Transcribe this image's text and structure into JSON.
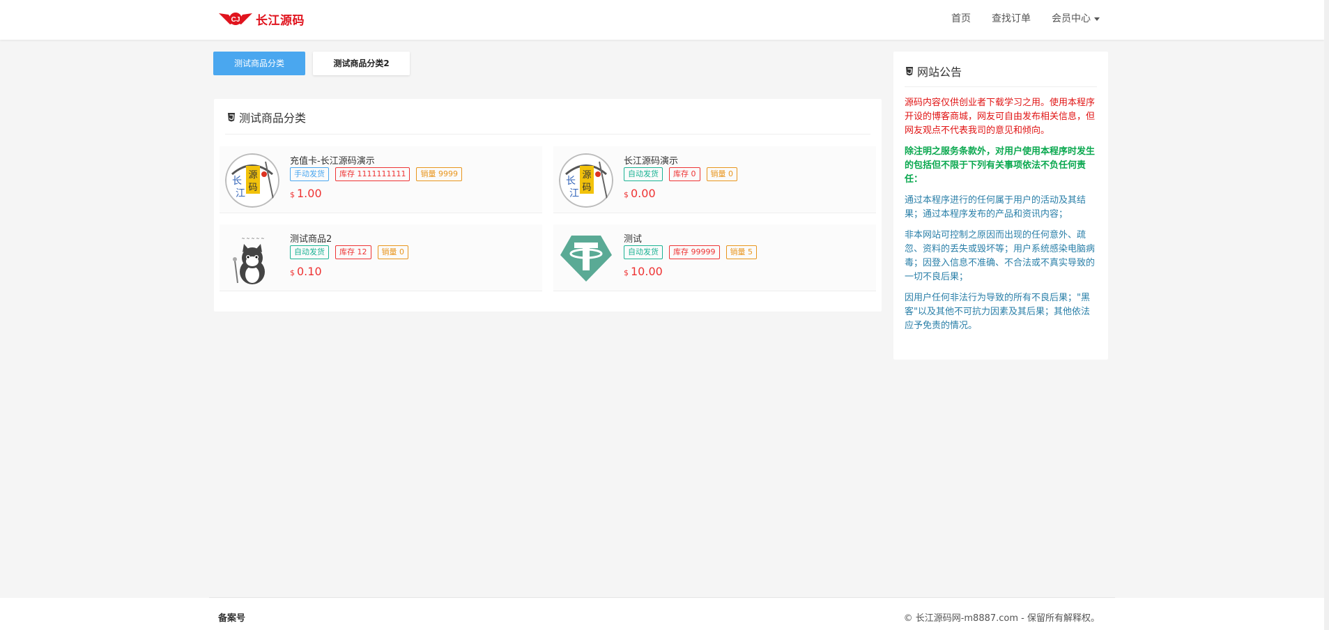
{
  "header": {
    "logo_text": "长江源码",
    "nav": [
      "首页",
      "查找订单",
      "会员中心"
    ]
  },
  "tabs": [
    "测试商品分类",
    "测试商品分类2"
  ],
  "panel": {
    "title": "测试商品分类",
    "products": [
      {
        "name": "充值卡-长江源码演示",
        "delivery": "手动发货",
        "stock": "库存 1111111111",
        "sales": "销量 9999",
        "currency": "$",
        "price": "1.00",
        "image": "changjiang-seal",
        "delivery_color": "blue"
      },
      {
        "name": "长江源码演示",
        "delivery": "自动发货",
        "stock": "库存 0",
        "sales": "销量 0",
        "currency": "$",
        "price": "0.00",
        "image": "changjiang-seal",
        "delivery_color": "green"
      },
      {
        "name": "测试商品2",
        "delivery": "自动发货",
        "stock": "库存 12",
        "sales": "销量 0",
        "currency": "$",
        "price": "0.10",
        "image": "cat-image",
        "delivery_color": "green"
      },
      {
        "name": "测试",
        "delivery": "自动发货",
        "stock": "库存 99999",
        "sales": "销量 5",
        "currency": "$",
        "price": "10.00",
        "image": "tether-icon",
        "delivery_color": "green"
      }
    ]
  },
  "notice": {
    "title": "网站公告",
    "p1": "源码内容仅供创业者下载学习之用。使用本程序开设的博客商城，网友可自由发布相关信息，但网友观点不代表我司的意见和倾向。",
    "p2": "除注明之服务条款外，对用户使用本程序时发生的包括但不限于下列有关事项依法不负任何责任：",
    "p3": "通过本程序进行的任何属于用户的活动及其结果；通过本程序发布的产品和资讯内容；",
    "p4": "非本网站可控制之原因而出现的任何意外、疏忽、资料的丢失或毁坏等；用户系统感染电脑病毒；因登入信息不准确、不合法或不真实导致的一切不良后果；",
    "p5": "因用户任何非法行为导致的所有不良后果；\"黑客\"以及其他不可抗力因素及其后果；其他依法应予免责的情况。"
  },
  "footer": {
    "left": "备案号",
    "right": "© 长江源码网-m8887.com - 保留所有解释权。"
  },
  "colors": {
    "accent": "#4aa7ef",
    "red": "#e33333",
    "green": "#1bb394",
    "orange": "#e8951c"
  }
}
